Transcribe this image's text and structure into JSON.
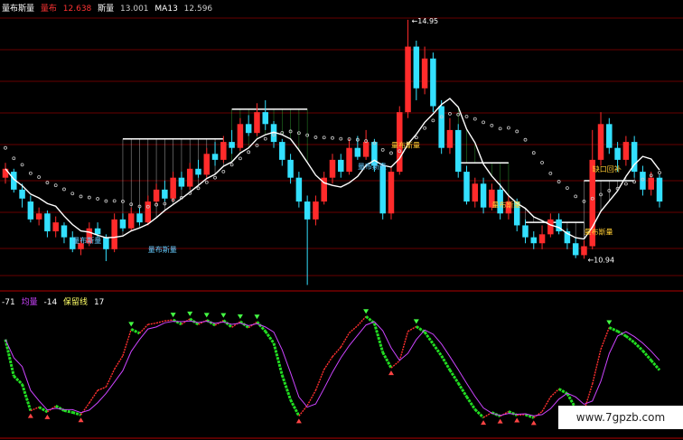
{
  "header": {
    "name": "量布斯量",
    "label": "量布",
    "val1": "12.638",
    "n2": "斯量",
    "val2": "13.001",
    "n3": "MA13",
    "val3": "12.596"
  },
  "sub_header": {
    "a": "-71",
    "b": "均量",
    "c": "-14",
    "d": "保留线",
    "e": "17"
  },
  "watermark": "www.7gpzb.com",
  "colors": {
    "up": "#ff2b2b",
    "down": "#33e0ff",
    "ma": "#ffffff",
    "green": "#22dd22",
    "purple": "#cc44ff",
    "grid": "#8b0000"
  },
  "chart_data": {
    "type": "candlestick",
    "price_high_label": "14.95",
    "price_low_label": "10.94",
    "annotations": [
      "量布斯量",
      "量布斯量",
      "量布斯量",
      "量布斯量",
      "量布斯量",
      "缺口回补",
      "量布斯量"
    ],
    "candles": [
      {
        "o": 12.3,
        "c": 12.45,
        "h": 12.55,
        "l": 12.2
      },
      {
        "o": 12.4,
        "c": 12.1,
        "h": 12.45,
        "l": 12.05
      },
      {
        "o": 12.1,
        "c": 11.95,
        "h": 12.2,
        "l": 11.8
      },
      {
        "o": 11.9,
        "c": 11.6,
        "h": 12.0,
        "l": 11.55
      },
      {
        "o": 11.6,
        "c": 11.7,
        "h": 11.8,
        "l": 11.5
      },
      {
        "o": 11.7,
        "c": 11.4,
        "h": 11.75,
        "l": 11.3
      },
      {
        "o": 11.4,
        "c": 11.55,
        "h": 11.65,
        "l": 11.3
      },
      {
        "o": 11.5,
        "c": 11.3,
        "h": 11.55,
        "l": 11.2
      },
      {
        "o": 11.3,
        "c": 11.1,
        "h": 11.4,
        "l": 11.05
      },
      {
        "o": 11.1,
        "c": 11.2,
        "h": 11.3,
        "l": 11.0
      },
      {
        "o": 11.2,
        "c": 11.45,
        "h": 11.55,
        "l": 11.15
      },
      {
        "o": 11.45,
        "c": 11.35,
        "h": 11.55,
        "l": 11.3
      },
      {
        "o": 11.3,
        "c": 11.1,
        "h": 11.35,
        "l": 10.9
      },
      {
        "o": 11.1,
        "c": 11.6,
        "h": 11.7,
        "l": 11.05
      },
      {
        "o": 11.6,
        "c": 11.45,
        "h": 11.7,
        "l": 11.4
      },
      {
        "o": 11.45,
        "c": 11.7,
        "h": 11.8,
        "l": 11.4
      },
      {
        "o": 11.7,
        "c": 11.55,
        "h": 11.8,
        "l": 11.5
      },
      {
        "o": 11.55,
        "c": 11.9,
        "h": 12.0,
        "l": 11.5
      },
      {
        "o": 11.9,
        "c": 12.1,
        "h": 12.2,
        "l": 11.85
      },
      {
        "o": 12.1,
        "c": 11.95,
        "h": 12.25,
        "l": 11.9
      },
      {
        "o": 11.95,
        "c": 12.3,
        "h": 12.4,
        "l": 11.9
      },
      {
        "o": 12.3,
        "c": 12.15,
        "h": 12.4,
        "l": 12.1
      },
      {
        "o": 12.15,
        "c": 12.45,
        "h": 12.55,
        "l": 12.1
      },
      {
        "o": 12.45,
        "c": 12.35,
        "h": 12.6,
        "l": 12.3
      },
      {
        "o": 12.35,
        "c": 12.7,
        "h": 12.8,
        "l": 12.3
      },
      {
        "o": 12.7,
        "c": 12.6,
        "h": 12.9,
        "l": 12.5
      },
      {
        "o": 12.6,
        "c": 12.9,
        "h": 13.0,
        "l": 12.55
      },
      {
        "o": 12.9,
        "c": 12.8,
        "h": 13.1,
        "l": 12.7
      },
      {
        "o": 12.8,
        "c": 13.2,
        "h": 13.3,
        "l": 12.75
      },
      {
        "o": 13.2,
        "c": 13.05,
        "h": 13.35,
        "l": 13.0
      },
      {
        "o": 13.05,
        "c": 13.4,
        "h": 13.55,
        "l": 13.0
      },
      {
        "o": 13.4,
        "c": 13.2,
        "h": 13.6,
        "l": 13.1
      },
      {
        "o": 13.2,
        "c": 12.9,
        "h": 13.25,
        "l": 12.8
      },
      {
        "o": 12.9,
        "c": 12.6,
        "h": 12.95,
        "l": 12.5
      },
      {
        "o": 12.6,
        "c": 12.3,
        "h": 12.7,
        "l": 12.2
      },
      {
        "o": 12.3,
        "c": 11.9,
        "h": 12.4,
        "l": 11.8
      },
      {
        "o": 11.9,
        "c": 11.6,
        "h": 12.0,
        "l": 10.5
      },
      {
        "o": 11.6,
        "c": 11.9,
        "h": 12.0,
        "l": 11.5
      },
      {
        "o": 11.9,
        "c": 12.3,
        "h": 12.4,
        "l": 11.85
      },
      {
        "o": 12.3,
        "c": 12.6,
        "h": 12.7,
        "l": 12.2
      },
      {
        "o": 12.6,
        "c": 12.4,
        "h": 12.7,
        "l": 12.3
      },
      {
        "o": 12.4,
        "c": 12.8,
        "h": 12.95,
        "l": 12.35
      },
      {
        "o": 12.8,
        "c": 12.65,
        "h": 13.0,
        "l": 12.6
      },
      {
        "o": 12.65,
        "c": 12.9,
        "h": 13.1,
        "l": 12.6
      },
      {
        "o": 12.9,
        "c": 12.5,
        "h": 12.95,
        "l": 12.4
      },
      {
        "o": 12.5,
        "c": 11.7,
        "h": 12.55,
        "l": 11.6
      },
      {
        "o": 11.7,
        "c": 12.4,
        "h": 12.5,
        "l": 11.6
      },
      {
        "o": 12.4,
        "c": 13.4,
        "h": 13.5,
        "l": 12.35
      },
      {
        "o": 13.4,
        "c": 14.5,
        "h": 14.95,
        "l": 13.3
      },
      {
        "o": 14.5,
        "c": 13.8,
        "h": 14.6,
        "l": 13.6
      },
      {
        "o": 13.8,
        "c": 14.3,
        "h": 14.5,
        "l": 13.7
      },
      {
        "o": 14.3,
        "c": 13.5,
        "h": 14.4,
        "l": 13.4
      },
      {
        "o": 13.5,
        "c": 12.8,
        "h": 13.6,
        "l": 12.7
      },
      {
        "o": 12.8,
        "c": 13.1,
        "h": 13.3,
        "l": 12.7
      },
      {
        "o": 13.1,
        "c": 12.4,
        "h": 13.2,
        "l": 12.3
      },
      {
        "o": 12.4,
        "c": 11.9,
        "h": 12.5,
        "l": 11.85
      },
      {
        "o": 11.9,
        "c": 12.2,
        "h": 12.3,
        "l": 11.8
      },
      {
        "o": 12.2,
        "c": 11.8,
        "h": 12.3,
        "l": 11.7
      },
      {
        "o": 11.8,
        "c": 12.1,
        "h": 12.2,
        "l": 11.75
      },
      {
        "o": 12.1,
        "c": 11.7,
        "h": 12.2,
        "l": 11.6
      },
      {
        "o": 11.7,
        "c": 11.9,
        "h": 12.0,
        "l": 11.6
      },
      {
        "o": 11.9,
        "c": 11.5,
        "h": 11.95,
        "l": 11.4
      },
      {
        "o": 11.5,
        "c": 11.3,
        "h": 11.6,
        "l": 11.2
      },
      {
        "o": 11.3,
        "c": 11.2,
        "h": 11.4,
        "l": 11.1
      },
      {
        "o": 11.2,
        "c": 11.35,
        "h": 11.5,
        "l": 11.1
      },
      {
        "o": 11.35,
        "c": 11.6,
        "h": 11.7,
        "l": 11.3
      },
      {
        "o": 11.6,
        "c": 11.4,
        "h": 11.7,
        "l": 11.35
      },
      {
        "o": 11.4,
        "c": 11.2,
        "h": 11.45,
        "l": 11.1
      },
      {
        "o": 11.2,
        "c": 11.0,
        "h": 11.3,
        "l": 10.95
      },
      {
        "o": 11.0,
        "c": 11.15,
        "h": 11.25,
        "l": 10.94
      },
      {
        "o": 11.15,
        "c": 12.6,
        "h": 13.1,
        "l": 11.1
      },
      {
        "o": 12.6,
        "c": 13.2,
        "h": 13.4,
        "l": 12.5
      },
      {
        "o": 13.2,
        "c": 12.8,
        "h": 13.3,
        "l": 12.7
      },
      {
        "o": 12.8,
        "c": 12.6,
        "h": 12.9,
        "l": 12.4
      },
      {
        "o": 12.6,
        "c": 12.9,
        "h": 13.0,
        "l": 12.5
      },
      {
        "o": 12.9,
        "c": 12.4,
        "h": 13.0,
        "l": 12.3
      },
      {
        "o": 12.4,
        "c": 12.1,
        "h": 12.5,
        "l": 12.0
      },
      {
        "o": 12.1,
        "c": 12.3,
        "h": 12.4,
        "l": 12.0
      },
      {
        "o": 12.3,
        "c": 11.9,
        "h": 12.35,
        "l": 11.8
      }
    ]
  }
}
